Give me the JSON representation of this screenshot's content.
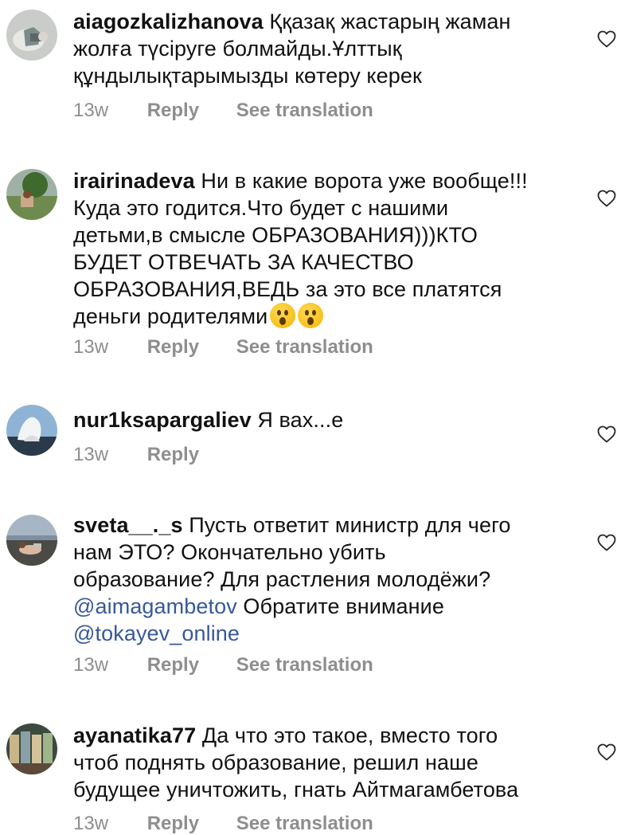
{
  "comments": [
    {
      "username": "aiagozkalizhanova",
      "lines": [
        "Ққазақ жастарың жаман",
        "жолға түсіруге болмайды.Ұлттық",
        "құндылықтарымызды көтеру керек"
      ],
      "time": "13w",
      "reply": "Reply",
      "see_translation": "See translation"
    },
    {
      "username": "irairinadeva",
      "lines": [
        "Ни в какие ворота уже вообще!!!",
        "Куда это годится.Что будет с нашими",
        "детьми,в смысле ОБРАЗОВАНИЯ)))КТО",
        "БУДЕТ ОТВЕЧАТЬ ЗА КАЧЕСТВО",
        "ОБРАЗОВАНИЯ,ВЕДЬ за это все платятся",
        "деньги родителями"
      ],
      "emojis": [
        "astonished-face",
        "astonished-face"
      ],
      "time": "13w",
      "reply": "Reply",
      "see_translation": "See translation"
    },
    {
      "username": "nur1ksapargaliev",
      "lines": [
        "Я вах...е"
      ],
      "time": "13w",
      "reply": "Reply"
    },
    {
      "username": "sveta__._s",
      "lines": [
        "Пусть ответит министр для чего",
        "нам ЭТО? Окончательно убить",
        "образование? Для растления молодёжи?"
      ],
      "mention1": "@aimagambetov",
      "after_mention1": "Обратите внимание",
      "mention2": "@tokayev_online",
      "time": "13w",
      "reply": "Reply",
      "see_translation": "See translation"
    },
    {
      "username": "ayanatika77",
      "lines": [
        "Да что это такое, вместо того",
        "чтоб поднять образование, решил наше",
        "будущее уничтожить, гнать Айтмагамбетова"
      ],
      "time": "13w",
      "reply": "Reply",
      "see_translation": "See translation"
    }
  ],
  "icons": {
    "like": "heart-outline-icon",
    "emoji": "astonished-face-emoji"
  },
  "colors": {
    "text": "#111111",
    "meta": "#8e8e8e",
    "mention": "#385898"
  }
}
